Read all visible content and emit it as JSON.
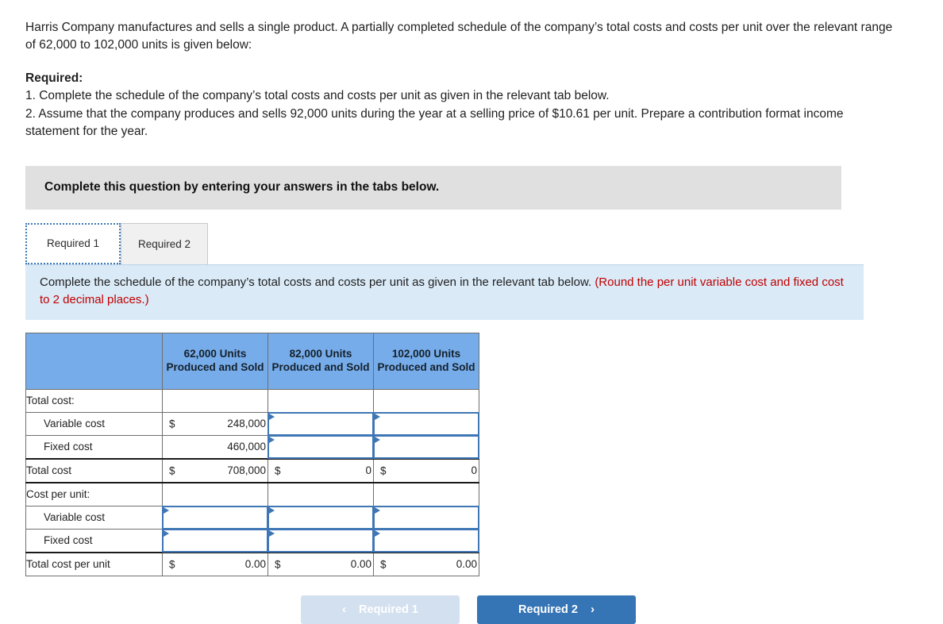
{
  "intro": "Harris Company manufactures and sells a single product. A partially completed schedule of the company’s total costs and costs per unit over the relevant range of 62,000 to 102,000 units is given below:",
  "required": {
    "title": "Required:",
    "items": [
      "1. Complete the schedule of the company’s total costs and costs per unit as given in the relevant tab below.",
      "2. Assume that the company produces and sells 92,000 units during the year at a selling price of $10.61 per unit. Prepare a contribution format income statement for the year."
    ]
  },
  "banner": {
    "text": "Complete this question by entering your answers in the tabs below."
  },
  "tabs": [
    {
      "label": "Required 1",
      "active": true
    },
    {
      "label": "Required 2",
      "active": false
    }
  ],
  "instruction": {
    "main": "Complete the schedule of the company’s total costs and costs per unit as given in the relevant tab below.",
    "hint": "(Round the per unit variable cost and fixed cost to 2 decimal places.)"
  },
  "schedule": {
    "headers": [
      "",
      "62,000 Units Produced and Sold",
      "82,000 Units Produced and Sold",
      "102,000 Units Produced and Sold"
    ],
    "rows": [
      {
        "label": "Total cost:",
        "indent": false,
        "cells": [
          {
            "kind": "blank"
          },
          {
            "kind": "blank"
          },
          {
            "kind": "blank"
          }
        ]
      },
      {
        "label": "Variable cost",
        "indent": true,
        "cells": [
          {
            "kind": "value",
            "currency": "$",
            "number": "248,000"
          },
          {
            "kind": "input",
            "value": ""
          },
          {
            "kind": "input",
            "value": ""
          }
        ]
      },
      {
        "label": "Fixed cost",
        "indent": true,
        "cells": [
          {
            "kind": "value",
            "currency": "",
            "number": "460,000"
          },
          {
            "kind": "input",
            "value": ""
          },
          {
            "kind": "input",
            "value": ""
          }
        ]
      },
      {
        "label": "Total cost",
        "indent": false,
        "rule": "both",
        "cells": [
          {
            "kind": "value",
            "currency": "$",
            "number": "708,000"
          },
          {
            "kind": "value",
            "currency": "$",
            "number": "0"
          },
          {
            "kind": "value",
            "currency": "$",
            "number": "0"
          }
        ]
      },
      {
        "label": "Cost per unit:",
        "indent": false,
        "cells": [
          {
            "kind": "blank"
          },
          {
            "kind": "blank"
          },
          {
            "kind": "blank"
          }
        ]
      },
      {
        "label": "Variable cost",
        "indent": true,
        "cells": [
          {
            "kind": "input",
            "value": ""
          },
          {
            "kind": "input",
            "value": ""
          },
          {
            "kind": "input",
            "value": ""
          }
        ]
      },
      {
        "label": "Fixed cost",
        "indent": true,
        "cells": [
          {
            "kind": "input",
            "value": ""
          },
          {
            "kind": "input",
            "value": ""
          },
          {
            "kind": "input",
            "value": ""
          }
        ]
      },
      {
        "label": "Total cost per unit",
        "indent": false,
        "rule": "top",
        "cells": [
          {
            "kind": "value",
            "currency": "$",
            "number": "0.00"
          },
          {
            "kind": "value",
            "currency": "$",
            "number": "0.00"
          },
          {
            "kind": "value",
            "currency": "$",
            "number": "0.00"
          }
        ]
      }
    ]
  },
  "nav": {
    "prev": {
      "label": "Required 1",
      "chevron": "‹",
      "icon": "chevron-left-icon",
      "disabled": true
    },
    "next": {
      "label": "Required 2",
      "chevron": "›",
      "icon": "chevron-right-icon",
      "disabled": false
    }
  },
  "colors": {
    "header_blue": "#76ace9",
    "instruction_blue": "#daeaf7",
    "banner_gray": "#e0e0e0",
    "primary_button": "#3574b5",
    "disabled_button": "#d3e0ef",
    "hint_red": "#c00000",
    "input_border": "#3f76b5"
  }
}
